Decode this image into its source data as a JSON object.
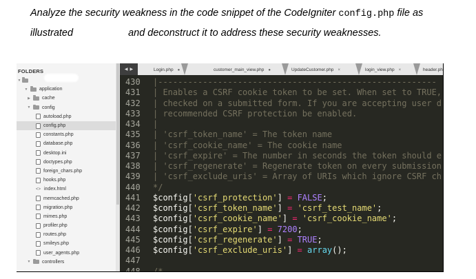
{
  "question": {
    "line1_a": "Analyze the security weakness in the code snippet of the CodeIgniter ",
    "line1_code": "config.php",
    "line1_b": " file as",
    "line2_a": "illustrated",
    "line2_b": "and deconstruct it to address these security weaknesses."
  },
  "sidebar": {
    "title": "FOLDERS",
    "items": [
      {
        "label": "application",
        "kind": "folder",
        "depth": 1,
        "open": true
      },
      {
        "label": "cache",
        "kind": "folder",
        "depth": 2,
        "open": false
      },
      {
        "label": "config",
        "kind": "folder",
        "depth": 2,
        "open": true
      },
      {
        "label": "autoload.php",
        "kind": "file",
        "depth": 3
      },
      {
        "label": "config.php",
        "kind": "file",
        "depth": 3,
        "selected": true
      },
      {
        "label": "constants.php",
        "kind": "file",
        "depth": 3
      },
      {
        "label": "database.php",
        "kind": "file",
        "depth": 3
      },
      {
        "label": "desktop.ini",
        "kind": "file",
        "depth": 3
      },
      {
        "label": "doctypes.php",
        "kind": "file",
        "depth": 3
      },
      {
        "label": "foreign_chars.php",
        "kind": "file",
        "depth": 3
      },
      {
        "label": "hooks.php",
        "kind": "file",
        "depth": 3
      },
      {
        "label": "index.html",
        "kind": "code",
        "depth": 3
      },
      {
        "label": "memcached.php",
        "kind": "file",
        "depth": 3
      },
      {
        "label": "migration.php",
        "kind": "file",
        "depth": 3
      },
      {
        "label": "mimes.php",
        "kind": "file",
        "depth": 3
      },
      {
        "label": "profiler.php",
        "kind": "file",
        "depth": 3
      },
      {
        "label": "routes.php",
        "kind": "file",
        "depth": 3
      },
      {
        "label": "smileys.php",
        "kind": "file",
        "depth": 3
      },
      {
        "label": "user_agents.php",
        "kind": "file",
        "depth": 3
      },
      {
        "label": "controllers",
        "kind": "folder",
        "depth": 2,
        "open": true
      }
    ]
  },
  "tabs": [
    {
      "label": "Login.php",
      "close": "●"
    },
    {
      "label": "customer_main_view.php",
      "close": "●"
    },
    {
      "label": "UpdateCustomer.php",
      "close": "×"
    },
    {
      "label": "login_view.php",
      "close": "×"
    },
    {
      "label": "header.php",
      "close": ""
    }
  ],
  "nav_arrows": [
    "◀",
    "▶"
  ],
  "lines": [
    {
      "n": "430",
      "parts": [
        [
          "c",
          "|--------------------------------------------------------"
        ]
      ]
    },
    {
      "n": "431",
      "parts": [
        [
          "c",
          "| Enables a CSRF cookie token to be set. When set to TRUE,"
        ]
      ]
    },
    {
      "n": "432",
      "parts": [
        [
          "c",
          "| checked on a submitted form. If you are accepting user d"
        ]
      ]
    },
    {
      "n": "433",
      "parts": [
        [
          "c",
          "| recommended CSRF protection be enabled."
        ]
      ]
    },
    {
      "n": "434",
      "parts": [
        [
          "c",
          "|"
        ]
      ]
    },
    {
      "n": "435",
      "parts": [
        [
          "c",
          "| 'csrf_token_name' = The token name"
        ]
      ]
    },
    {
      "n": "436",
      "parts": [
        [
          "c",
          "| 'csrf_cookie_name' = The cookie name"
        ]
      ]
    },
    {
      "n": "437",
      "parts": [
        [
          "c",
          "| 'csrf_expire' = The number in seconds the token should e"
        ]
      ]
    },
    {
      "n": "438",
      "parts": [
        [
          "c",
          "| 'csrf_regenerate' = Regenerate token on every submission"
        ]
      ]
    },
    {
      "n": "439",
      "parts": [
        [
          "c",
          "| 'csrf_exclude_uris' = Array of URIs which ignore CSRF ch"
        ]
      ]
    },
    {
      "n": "440",
      "parts": [
        [
          "c",
          "*/"
        ]
      ]
    },
    {
      "n": "441",
      "parts": [
        [
          "v",
          "$config"
        ],
        [
          "p",
          "["
        ],
        [
          "s",
          "'csrf_protection'"
        ],
        [
          "p",
          "] "
        ],
        [
          "o",
          "="
        ],
        [
          "p",
          " "
        ],
        [
          "k",
          "FALSE"
        ],
        [
          "p",
          ";"
        ]
      ]
    },
    {
      "n": "442",
      "parts": [
        [
          "v",
          "$config"
        ],
        [
          "p",
          "["
        ],
        [
          "s",
          "'csrf_token_name'"
        ],
        [
          "p",
          "] "
        ],
        [
          "o",
          "="
        ],
        [
          "p",
          " "
        ],
        [
          "s",
          "'csrf_test_name'"
        ],
        [
          "p",
          ";"
        ]
      ]
    },
    {
      "n": "443",
      "parts": [
        [
          "v",
          "$config"
        ],
        [
          "p",
          "["
        ],
        [
          "s",
          "'csrf_cookie_name'"
        ],
        [
          "p",
          "] "
        ],
        [
          "o",
          "="
        ],
        [
          "p",
          " "
        ],
        [
          "s",
          "'csrf_cookie_name'"
        ],
        [
          "p",
          ";"
        ]
      ]
    },
    {
      "n": "444",
      "parts": [
        [
          "v",
          "$config"
        ],
        [
          "p",
          "["
        ],
        [
          "s",
          "'csrf_expire'"
        ],
        [
          "p",
          "] "
        ],
        [
          "o",
          "="
        ],
        [
          "p",
          " "
        ],
        [
          "k",
          "7200"
        ],
        [
          "p",
          ";"
        ]
      ]
    },
    {
      "n": "445",
      "parts": [
        [
          "v",
          "$config"
        ],
        [
          "p",
          "["
        ],
        [
          "s",
          "'csrf_regenerate'"
        ],
        [
          "p",
          "] "
        ],
        [
          "o",
          "="
        ],
        [
          "p",
          " "
        ],
        [
          "k",
          "TRUE"
        ],
        [
          "p",
          ";"
        ]
      ]
    },
    {
      "n": "446",
      "parts": [
        [
          "v",
          "$config"
        ],
        [
          "p",
          "["
        ],
        [
          "s",
          "'csrf_exclude_uris'"
        ],
        [
          "p",
          "] "
        ],
        [
          "o",
          "="
        ],
        [
          "p",
          " "
        ],
        [
          "f",
          "array"
        ],
        [
          "p",
          "();"
        ]
      ]
    },
    {
      "n": "447",
      "parts": []
    },
    {
      "n": "448",
      "parts": [
        [
          "c",
          "/*"
        ]
      ]
    }
  ],
  "colors": {
    "editor_bg": "#272822",
    "comment": "#75715e",
    "string": "#e6db74",
    "operator": "#f92672",
    "constant": "#ae81ff",
    "function": "#66d9ef"
  }
}
